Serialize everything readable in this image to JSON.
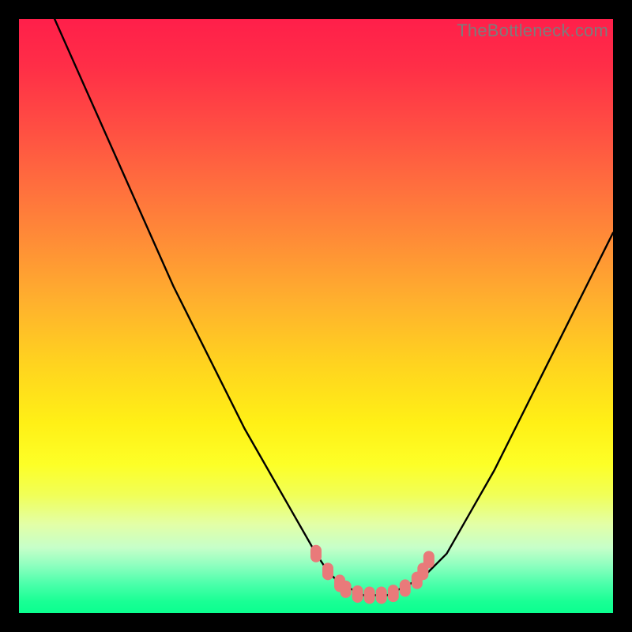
{
  "watermark": "TheBottleneck.com",
  "colors": {
    "frame_bg": "#000000",
    "curve_stroke": "#000000",
    "marker_fill": "#e97a7a",
    "watermark_color": "#7c7c7c",
    "gradient_top": "#ff1f4a",
    "gradient_bottom": "#0bff8f"
  },
  "chart_data": {
    "type": "line",
    "title": "",
    "xlabel": "",
    "ylabel": "",
    "xlim": [
      0,
      100
    ],
    "ylim": [
      0,
      100
    ],
    "series": [
      {
        "name": "bottleneck-curve",
        "x": [
          6,
          10,
          14,
          18,
          22,
          26,
          30,
          34,
          38,
          42,
          46,
          50,
          52,
          54,
          56,
          58,
          60,
          62,
          64,
          68,
          72,
          76,
          80,
          84,
          88,
          92,
          96,
          100
        ],
        "y": [
          100,
          91,
          82,
          73,
          64,
          55,
          47,
          39,
          31,
          24,
          17,
          10,
          7,
          5,
          4,
          3,
          3,
          3,
          4,
          6,
          10,
          17,
          24,
          32,
          40,
          48,
          56,
          64
        ]
      }
    ],
    "markers": {
      "name": "highlight-points",
      "points": [
        {
          "x": 50,
          "y": 10
        },
        {
          "x": 52,
          "y": 7
        },
        {
          "x": 54,
          "y": 5
        },
        {
          "x": 55,
          "y": 4
        },
        {
          "x": 57,
          "y": 3.2
        },
        {
          "x": 59,
          "y": 3
        },
        {
          "x": 61,
          "y": 3
        },
        {
          "x": 63,
          "y": 3.3
        },
        {
          "x": 65,
          "y": 4.2
        },
        {
          "x": 67,
          "y": 5.5
        },
        {
          "x": 68,
          "y": 7
        },
        {
          "x": 69,
          "y": 9
        }
      ]
    },
    "annotations": []
  }
}
